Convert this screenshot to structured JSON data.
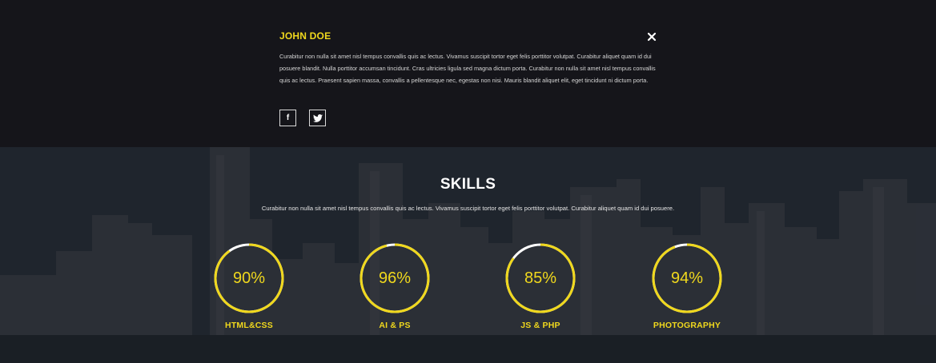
{
  "profile": {
    "name": "JOHN DOE",
    "bio": "Curabitur non nulla sit amet nisl tempus convallis quis ac lectus. Vivamus suscipit tortor eget felis porttitor volutpat. Curabitur aliquet quam id dui posuere blandit. Nulla porttitor accumsan tincidunt. Cras ultricies ligula sed magna dictum porta. Curabitur non nulla sit amet nisl tempus convallis quis ac lectus. Praesent sapien massa, convallis a pellentesque nec, egestas non nisi. Mauris blandit aliquet elit, eget tincidunt ni dictum porta.",
    "social": [
      {
        "icon": "facebook-icon",
        "glyph": "f"
      },
      {
        "icon": "twitter-icon",
        "glyph": ""
      }
    ],
    "close_icon": "close-icon"
  },
  "skills": {
    "title": "SKILLS",
    "subtitle": "Curabitur non nulla sit amet nisl tempus convallis quis ac lectus. Vivamus suscipit tortor eget felis porttitor volutpat. Curabitur aliquet quam id dui posuere.",
    "items": [
      {
        "label": "HTML&CSS",
        "percent_text": "90%",
        "percent": 90
      },
      {
        "label": "AI & PS",
        "percent_text": "96%",
        "percent": 96
      },
      {
        "label": "JS & PHP",
        "percent_text": "85%",
        "percent": 85
      },
      {
        "label": "PHOTOGRAPHY",
        "percent_text": "94%",
        "percent": 94
      }
    ]
  },
  "colors": {
    "accent": "#f0d81d",
    "ring_track": "#ffffff",
    "panel_bg": "#15151a"
  }
}
